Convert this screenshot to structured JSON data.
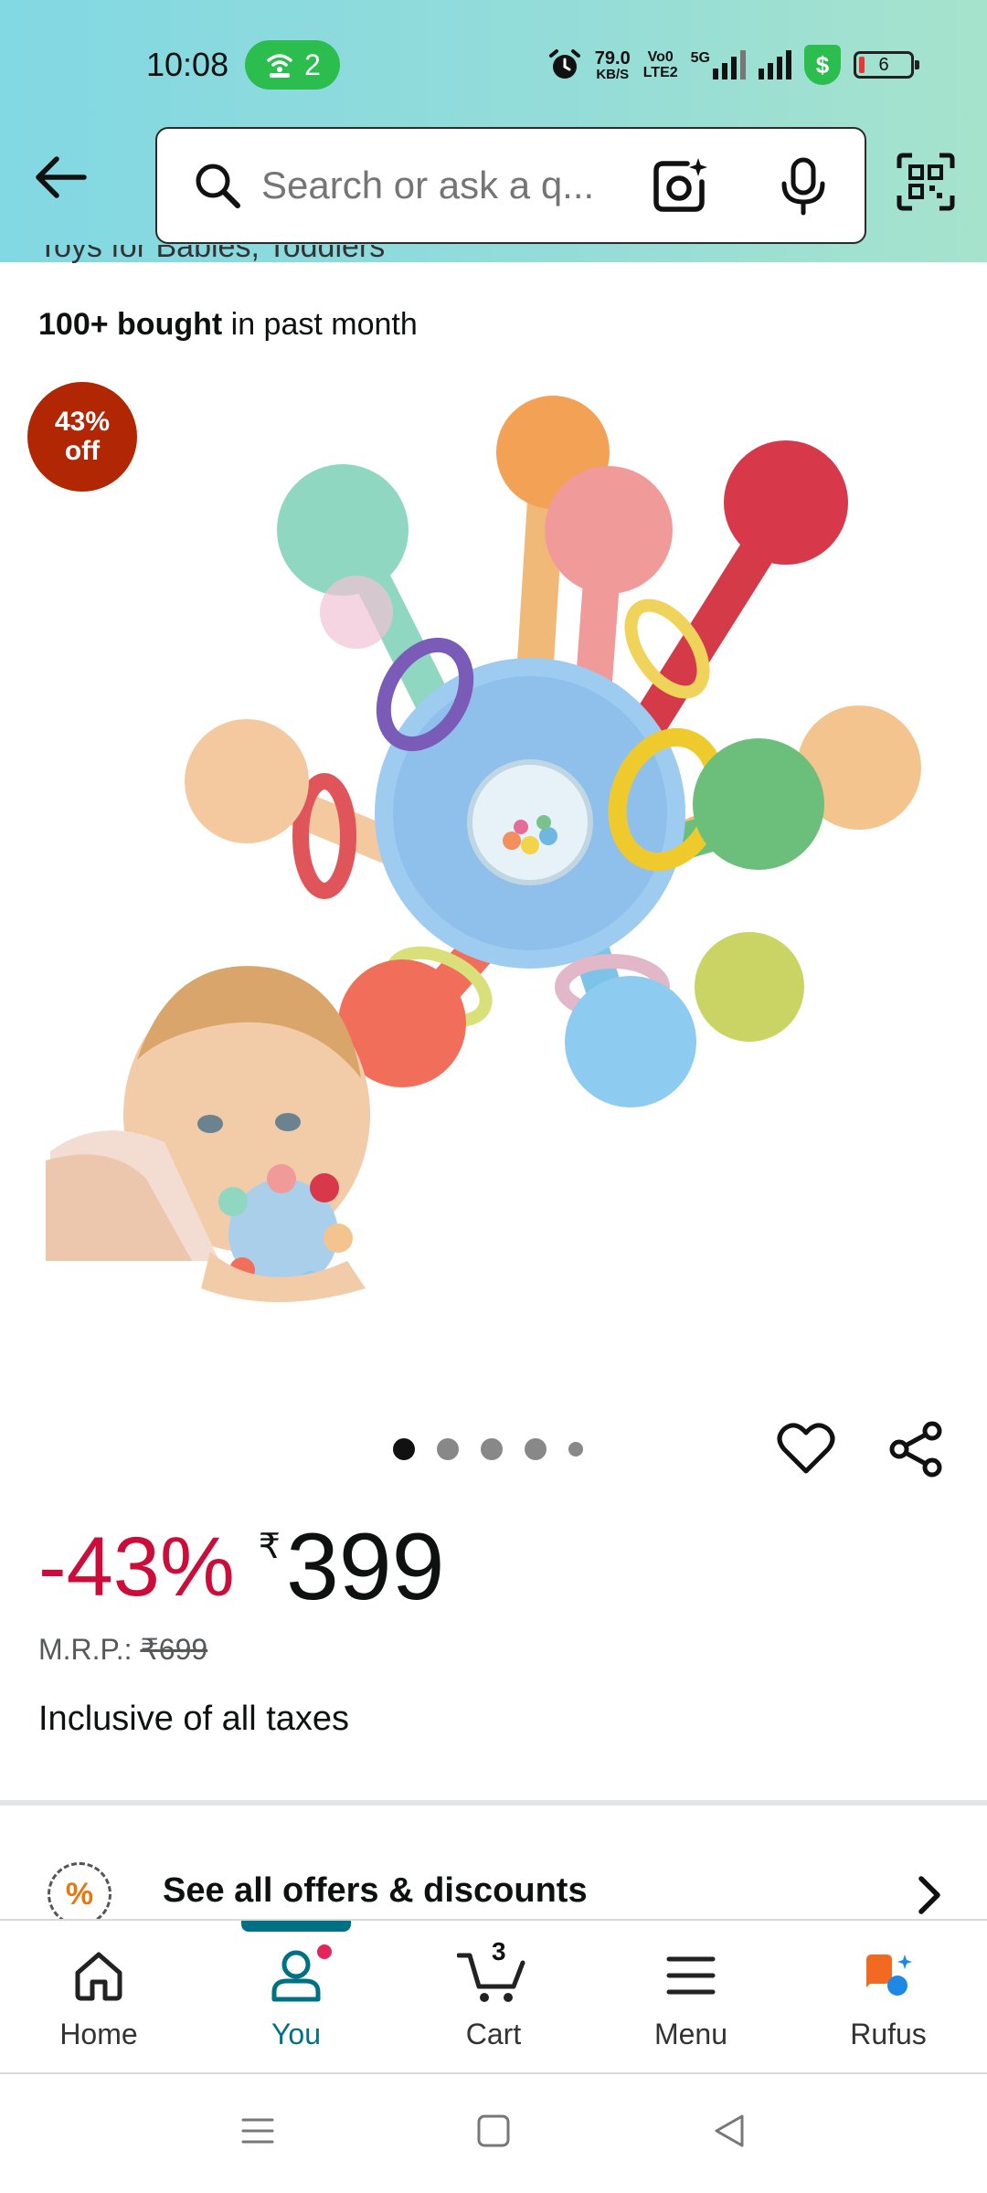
{
  "status_bar": {
    "time": "10:08",
    "hotspot_count": "2",
    "net_speed_value": "79.0",
    "net_speed_unit": "KB/S",
    "volte_line1": "Vo0",
    "volte_line2": "LTE2",
    "network_type": "5G",
    "shield_symbol": "$",
    "battery_level": "6"
  },
  "header": {
    "search_placeholder": "Search or ask a q..."
  },
  "product": {
    "subtitle_partial": "Toys for Babies, Toddlers",
    "bought_bold": "100+ bought",
    "bought_rest": " in past month",
    "discount_badge_line1": "43%",
    "discount_badge_line2": "off",
    "image_carousel": {
      "total": 5,
      "active_index": 0
    },
    "price": {
      "discount_percent": "-43%",
      "currency_symbol": "₹",
      "amount": "399",
      "mrp_label": "M.R.P.: ",
      "mrp_value": "₹699",
      "tax_note": "Inclusive of all taxes"
    },
    "offers_label": "See all offers & discounts",
    "offers_icon_symbol": "%"
  },
  "bottom_nav": {
    "items": [
      {
        "label": "Home",
        "icon": "home-icon"
      },
      {
        "label": "You",
        "icon": "person-icon",
        "active": true
      },
      {
        "label": "Cart",
        "icon": "cart-icon",
        "badge": "3"
      },
      {
        "label": "Menu",
        "icon": "menu-icon"
      },
      {
        "label": "Rufus",
        "icon": "rufus-icon"
      }
    ]
  },
  "colors": {
    "header_gradient_start": "#82d8e3",
    "header_gradient_end": "#a6e3cc",
    "discount_red": "#cc0c39",
    "badge_red": "#b12704",
    "active_teal": "#007185",
    "rufus_orange": "#f26a21",
    "rufus_blue": "#1e88e5"
  }
}
